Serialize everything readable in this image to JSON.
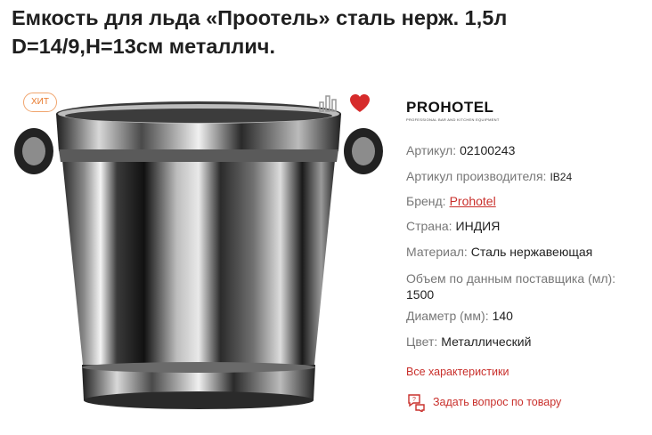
{
  "product": {
    "title_line1": "Емкость для льда «Проотель» сталь нерж. 1,5л",
    "title_line2": "D=14/9,H=13см металлич."
  },
  "gallery": {
    "badge": "ХИТ",
    "compare_icon": "compare-icon",
    "favorite_icon": "heart-icon",
    "favorite_color": "#d62b2b"
  },
  "brand_logo": {
    "text": "PROHOTEL",
    "subtitle": "PROFESSIONAL BAR AND KITCHEN EQUIPMENT"
  },
  "specs": {
    "article_label": "Артикул:",
    "article_value": "02100243",
    "mfr_article_label": "Артикул производителя:",
    "mfr_article_value": "IB24",
    "brand_label": "Бренд:",
    "brand_value": "Prohotel",
    "country_label": "Страна:",
    "country_value": "ИНДИЯ",
    "material_label": "Материал:",
    "material_value": "Сталь нержавеющая",
    "volume_label": "Объем по данным поставщика (мл):",
    "volume_value": "1500",
    "diameter_label": "Диаметр (мм):",
    "diameter_value": "140",
    "color_label": "Цвет:",
    "color_value": "Металлический"
  },
  "links": {
    "all_specs": "Все характеристики",
    "ask_question": "Задать вопрос по товару"
  },
  "colors": {
    "accent": "#c9302c",
    "badge": "#e8792b"
  }
}
